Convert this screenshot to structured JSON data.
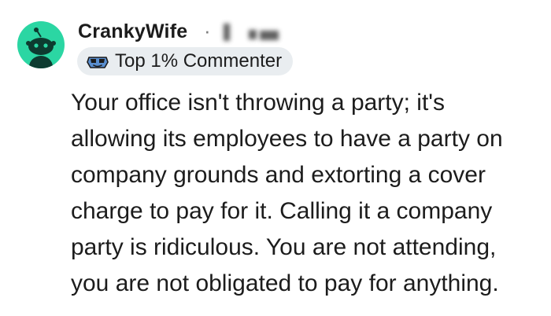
{
  "comment": {
    "username": "CrankyWife",
    "separator": "·",
    "flair": {
      "icon": "sunglasses-badge-icon",
      "label": "Top 1% Commenter"
    },
    "body_lines": [
      "Your office isn't throwing a party; it's",
      "allowing its employees to have a party on",
      "company grounds and extorting a cover",
      "charge to pay for it. Calling it a company",
      "party is ridiculous. You are not attending,",
      "you are not obligated to pay for anything."
    ],
    "avatar": {
      "icon": "snoo-avatar-icon",
      "color": "#2bd6a3"
    }
  }
}
